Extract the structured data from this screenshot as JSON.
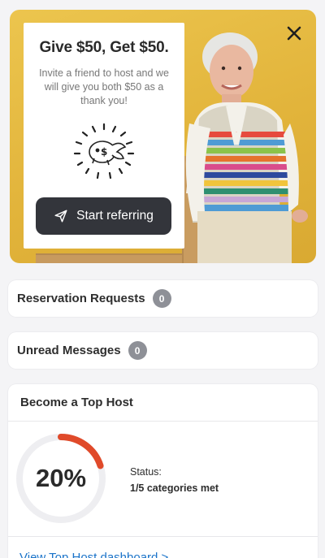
{
  "promo": {
    "title": "Give $50, Get $50.",
    "body": "Invite a friend to host and we will give you both $50 as a thank you!",
    "cta_label": "Start referring",
    "close_icon": "close-icon",
    "illustration": "piggy-bank-icon"
  },
  "reservation_requests": {
    "label": "Reservation Requests",
    "count": "0"
  },
  "unread_messages": {
    "label": "Unread Messages",
    "count": "0"
  },
  "top_host": {
    "title": "Become a Top Host",
    "percent_text": "20%",
    "progress": 0.2,
    "status_label": "Status:",
    "status_value": "1/5 categories met",
    "link_label": "View Top Host dashboard >"
  },
  "colors": {
    "promo_bg": "#e2b43b",
    "cta_bg": "#33353b",
    "progress_accent": "#e04a2a",
    "badge_bg": "#8e9097",
    "link": "#1a73c9"
  }
}
